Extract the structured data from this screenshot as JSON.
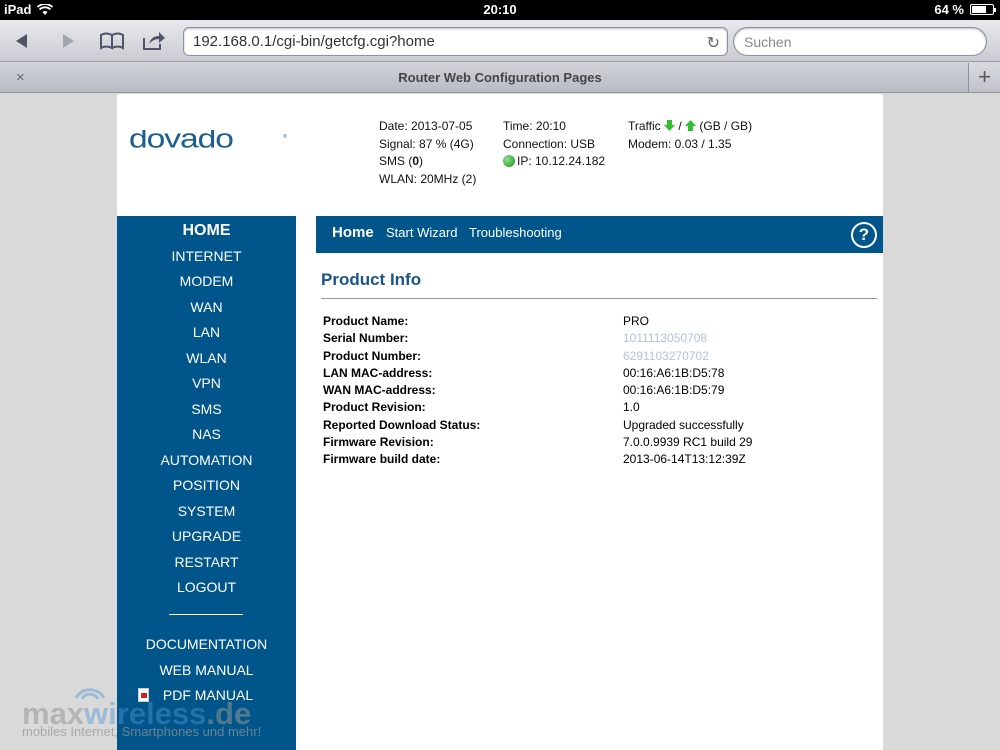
{
  "status_bar": {
    "device": "iPad",
    "time": "20:10",
    "battery": "64 %"
  },
  "browser": {
    "url": "192.168.0.1/cgi-bin/getcfg.cgi?home",
    "search_placeholder": "Suchen",
    "tab_title": "Router Web Configuration Pages",
    "tab_close": "×",
    "tab_add": "+"
  },
  "header": {
    "logo_text": "dovado",
    "date": "Date: 2013-07-05",
    "signal": "Signal: 87 % (4G)",
    "sms_prefix": "SMS (",
    "sms_count": "0",
    "sms_suffix": ")",
    "wlan": "WLAN: 20MHz (2)",
    "time": "Time: 20:10",
    "connection": "Connection: USB",
    "ip": "IP: 10.12.24.182",
    "traffic_label": "Traffic",
    "traffic_sep": "/",
    "traffic_unit": "(GB / GB)",
    "modem": "Modem: 0.03 / 1.35"
  },
  "sidebar": {
    "items": [
      "HOME",
      "INTERNET",
      "MODEM",
      "WAN",
      "LAN",
      "WLAN",
      "VPN",
      "SMS",
      "NAS",
      "AUTOMATION",
      "POSITION",
      "SYSTEM",
      "UPGRADE",
      "RESTART",
      "LOGOUT"
    ],
    "links": [
      "DOCUMENTATION",
      "WEB MANUAL",
      "PDF MANUAL"
    ]
  },
  "topnav": {
    "home": "Home",
    "wizard": "Start Wizard",
    "troubleshooting": "Troubleshooting",
    "help": "?"
  },
  "content": {
    "title": "Product Info",
    "rows": [
      {
        "label": "Product Name:",
        "value": "PRO"
      },
      {
        "label": "Serial Number:",
        "value": "1011113050708"
      },
      {
        "label": "Product Number:",
        "value": "6291103270702"
      },
      {
        "label": "LAN MAC-address:",
        "value": "00:16:A6:1B:D5:78"
      },
      {
        "label": "WAN MAC-address:",
        "value": "00:16:A6:1B:D5:79"
      },
      {
        "label": "Product Revision:",
        "value": "1.0"
      },
      {
        "label": "Reported Download Status:",
        "value": "Upgraded successfully"
      },
      {
        "label": "Firmware Revision:",
        "value": "7.0.0.9939 RC1 build 29"
      },
      {
        "label": "Firmware build date:",
        "value": "2013-06-14T13:12:39Z"
      }
    ]
  },
  "watermark": {
    "brand_a": "max",
    "brand_b": "wireless",
    "brand_c": ".de",
    "tagline": "mobiles Internet, Smartphones und mehr!"
  },
  "colors": {
    "nav_blue": "#00558a",
    "title_blue": "#1a5588",
    "light_value": "#b4c3dc"
  }
}
